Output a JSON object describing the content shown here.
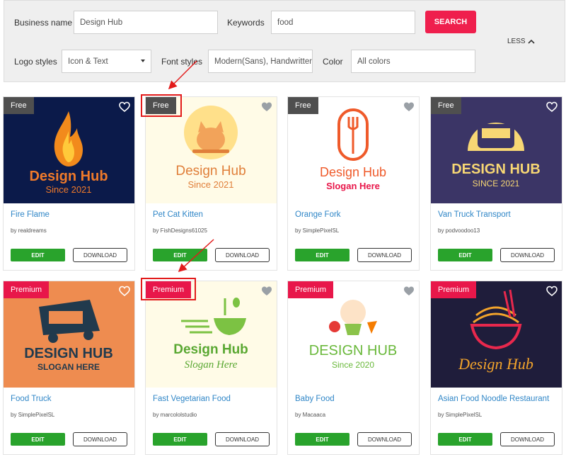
{
  "filters": {
    "business_name_label": "Business name",
    "business_name_value": "Design Hub",
    "keywords_label": "Keywords",
    "keywords_value": "food",
    "search_label": "SEARCH",
    "less_label": "LESS",
    "logo_styles_label": "Logo styles",
    "logo_styles_value": "Icon & Text",
    "font_styles_label": "Font styles",
    "font_styles_value": "Modern(Sans), Handwritten",
    "color_label": "Color",
    "color_value": "All colors"
  },
  "card_actions": {
    "edit": "EDIT",
    "download": "DOWNLOAD"
  },
  "cards": [
    {
      "badge": "Free",
      "title": "Fire Flame",
      "author": "by realdreams",
      "logo_line1": "Design Hub",
      "logo_line2": "Since 2021"
    },
    {
      "badge": "Free",
      "title": "Pet Cat Kitten",
      "author": "by FishDesigns61025",
      "logo_line1": "Design Hub",
      "logo_line2": "Since 2021"
    },
    {
      "badge": "Free",
      "title": "Orange Fork",
      "author": "by SimplePixelSL",
      "logo_line1": "Design Hub",
      "logo_line2": "Slogan Here"
    },
    {
      "badge": "Free",
      "title": "Van Truck Transport",
      "author": "by podvoodoo13",
      "logo_line1": "DESIGN HUB",
      "logo_line2": "SINCE 2021"
    },
    {
      "badge": "Premium",
      "title": "Food Truck",
      "author": "by SimplePixelSL",
      "logo_line1": "DESIGN HUB",
      "logo_line2": "SLOGAN HERE"
    },
    {
      "badge": "Premium",
      "title": "Fast Vegetarian Food",
      "author": "by marcololstudio",
      "logo_line1": "Design Hub",
      "logo_line2": "Slogan Here"
    },
    {
      "badge": "Premium",
      "title": "Baby Food",
      "author": "by Macaaca",
      "logo_line1": "DESIGN HUB",
      "logo_line2": "Since 2020"
    },
    {
      "badge": "Premium",
      "title": "Asian Food Noodle Restaurant",
      "author": "by SimplePixelSL",
      "logo_line1": "Design Hub",
      "logo_line2": ""
    }
  ],
  "colors": {
    "accent": "#ef1f4d",
    "free_badge": "#4f4f4f",
    "premium_badge": "#e8174a",
    "edit": "#29a32c",
    "link": "#2f86c7",
    "annotation": "#e21b1b"
  }
}
